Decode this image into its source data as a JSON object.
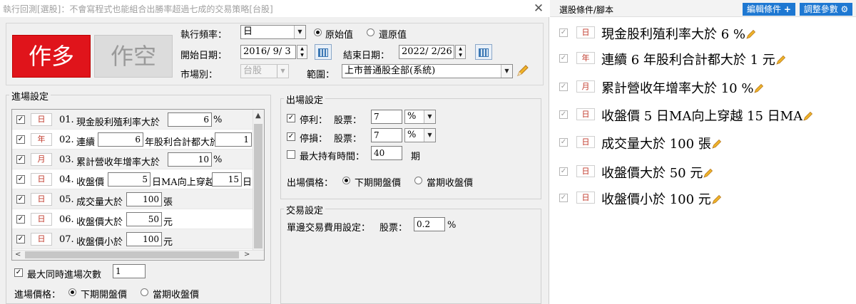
{
  "window": {
    "title": "執行回測[選股]：不會寫程式也能組合出勝率超過七成的交易策略[台股]",
    "close_icon": "close-icon"
  },
  "direction": {
    "long_label": "作多",
    "short_label": "作空"
  },
  "settings": {
    "frequency_label": "執行頻率：",
    "frequency_value": "日",
    "price_mode_original": "原始值",
    "price_mode_restored": "還原值",
    "start_date_label": "開始日期：",
    "start_date_value": "2016/ 9/ 3",
    "end_date_label": "結束日期：",
    "end_date_value": "2022/ 2/26",
    "market_label": "市場別：",
    "market_value": "台股",
    "scope_label": "範圍：",
    "scope_value": "上市普通股全部(系統)"
  },
  "entry": {
    "group_label": "進場設定",
    "rows": [
      {
        "freq": "日",
        "num": "01.",
        "parts": [
          "現金股利殖利率大於"
        ],
        "fields": [
          "6"
        ],
        "tail": "%"
      },
      {
        "freq": "年",
        "num": "02.",
        "parts": [
          "連續"
        ],
        "fields": [
          "6"
        ],
        "mid": "年股利合計都大於",
        "field2": "1",
        "tail": ""
      },
      {
        "freq": "月",
        "num": "03.",
        "parts": [
          "累計營收年增率大於"
        ],
        "fields": [
          "10"
        ],
        "tail": "%"
      },
      {
        "freq": "日",
        "num": "04.",
        "parts": [
          "收盤價"
        ],
        "fields": [
          "5"
        ],
        "mid": "日MA向上穿越",
        "field2": "15",
        "tail": "日"
      },
      {
        "freq": "日",
        "num": "05.",
        "parts": [
          "成交量大於"
        ],
        "fields": [
          "100"
        ],
        "tail": "張"
      },
      {
        "freq": "日",
        "num": "06.",
        "parts": [
          "收盤價大於"
        ],
        "fields": [
          "50"
        ],
        "tail": "元"
      },
      {
        "freq": "日",
        "num": "07.",
        "parts": [
          "收盤價小於"
        ],
        "fields": [
          "100"
        ],
        "tail": "元"
      }
    ],
    "max_entries_label": "最大同時進場次數",
    "max_entries_value": "1",
    "price_label": "進場價格：",
    "price_next_open": "下期開盤價",
    "price_close": "當期收盤價"
  },
  "exit": {
    "group_label": "出場設定",
    "take_profit_label": "停利：",
    "stop_loss_label": "停損：",
    "stock_label": "股票：",
    "take_profit_value": "7",
    "stop_loss_value": "7",
    "unit": "%",
    "max_hold_label": "最大持有時間：",
    "max_hold_value": "40",
    "max_hold_unit": "期",
    "price_label": "出場價格：",
    "price_next_open": "下期開盤價",
    "price_close": "當期收盤價"
  },
  "trade": {
    "group_label": "交易設定",
    "fee_label": "單邊交易費用設定：",
    "stock_label": "股票：",
    "fee_value": "0.2",
    "fee_unit": "%"
  },
  "conditions_panel": {
    "title": "選股條件/腳本",
    "edit_button": "編輯條件",
    "edit_button_icon": "plus-icon",
    "adjust_button": "調整參數",
    "adjust_button_icon": "gear-icon",
    "items": [
      {
        "freq": "日",
        "text": "現金股利殖利率大於 6 %"
      },
      {
        "freq": "年",
        "text": "連續 6 年股利合計都大於 1 元"
      },
      {
        "freq": "月",
        "text": "累計營收年增率大於 10 %"
      },
      {
        "freq": "日",
        "text": "收盤價 5 日MA向上穿越 15 日MA"
      },
      {
        "freq": "日",
        "text": "成交量大於 100 張"
      },
      {
        "freq": "日",
        "text": "收盤價大於 50 元"
      },
      {
        "freq": "日",
        "text": "收盤價小於 100 元"
      }
    ]
  },
  "colors": {
    "long": "#e0141b",
    "accent": "#1e78d2",
    "badge_text": "#c0392b"
  }
}
